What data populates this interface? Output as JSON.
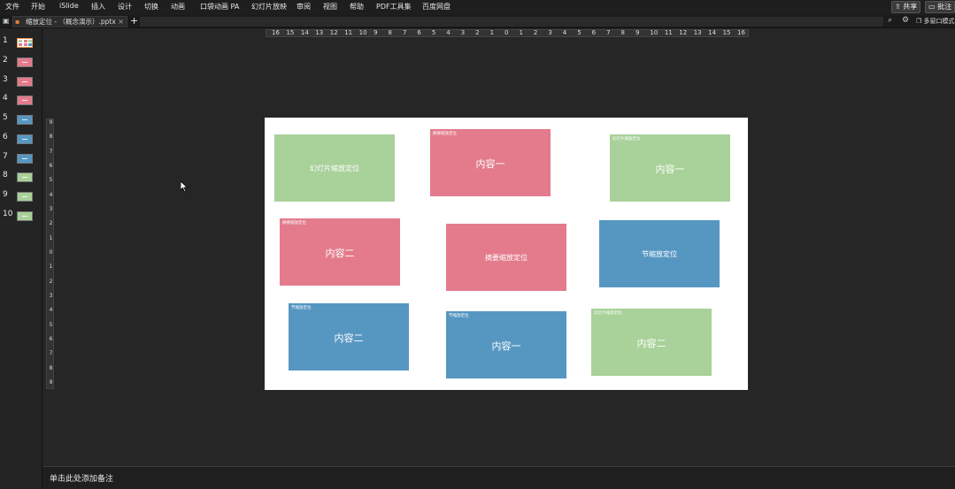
{
  "menu": {
    "items": [
      "文件",
      "开始",
      "iSlide",
      "插入",
      "设计",
      "切换",
      "动画",
      "口袋动画 PA",
      "幻灯片放映",
      "审阅",
      "视图",
      "帮助",
      "PDF工具集",
      "百度网盘"
    ],
    "share_label": "共享",
    "comment_label": "批注"
  },
  "tabs": {
    "doc_title": "缩放定位 - （概念演示）.pptx",
    "close": "×",
    "add": "+",
    "multi_window": "多窗口模式"
  },
  "thumbnails": {
    "numbers": [
      "1",
      "2",
      "3",
      "4",
      "5",
      "6",
      "7",
      "8",
      "9",
      "10"
    ],
    "colors": [
      "#ffffff",
      "#e37b8c",
      "#e37b8c",
      "#e37b8c",
      "#5697c2",
      "#5697c2",
      "#5697c2",
      "#a9d19a",
      "#a9d19a",
      "#a9d19a"
    ]
  },
  "ruler": {
    "h_labels": [
      "16",
      "15",
      "14",
      "13",
      "12",
      "11",
      "10",
      "9",
      "8",
      "7",
      "6",
      "5",
      "4",
      "3",
      "2",
      "1",
      "0",
      "1",
      "2",
      "3",
      "4",
      "5",
      "6",
      "7",
      "8",
      "9",
      "10",
      "11",
      "12",
      "13",
      "14",
      "15",
      "16"
    ],
    "v_labels": [
      "9",
      "8",
      "7",
      "6",
      "5",
      "4",
      "3",
      "2",
      "1",
      "0",
      "1",
      "2",
      "3",
      "4",
      "5",
      "6",
      "7",
      "8",
      "9"
    ]
  },
  "slide": {
    "cards": [
      {
        "small": "",
        "text": "幻灯片缩放定位"
      },
      {
        "small": "摘要缩放定位",
        "text": "内容一"
      },
      {
        "small": "幻灯片缩放定位",
        "text": "内容一"
      },
      {
        "small": "摘要缩放定位",
        "text": "内容二"
      },
      {
        "small": "",
        "text": "摘要缩放定位"
      },
      {
        "small": "",
        "text": "节缩放定位"
      },
      {
        "small": "节缩放定位",
        "text": "内容二"
      },
      {
        "small": "节缩放定位",
        "text": "内容一"
      },
      {
        "small": "幻灯片缩放定位",
        "text": "内容二"
      }
    ]
  },
  "notes": {
    "placeholder": "单击此处添加备注"
  },
  "colors": {
    "green": "#a9d19a",
    "pink": "#e37b8c",
    "blue": "#5697c2"
  }
}
